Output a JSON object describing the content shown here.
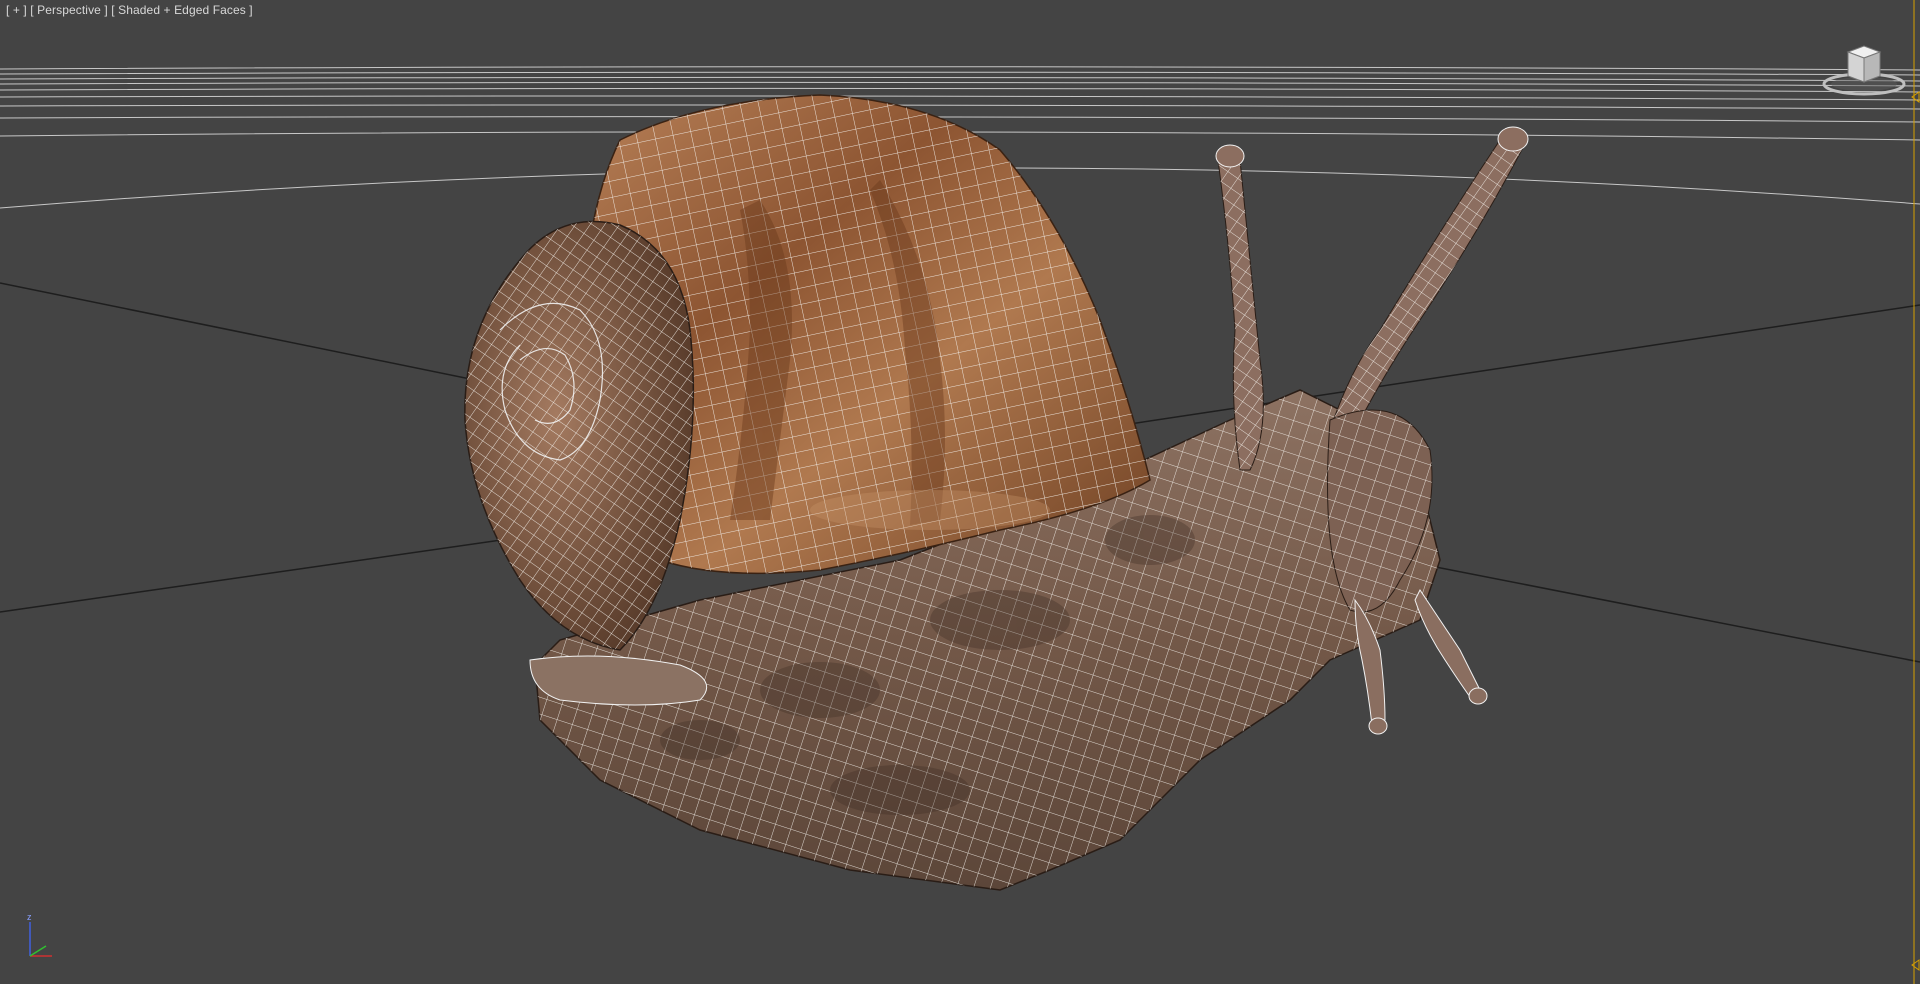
{
  "viewport": {
    "label_menu": "[ + ]",
    "label_view": "[ Perspective ]",
    "label_shading": "[ Shaded + Edged Faces ]"
  },
  "axis": {
    "z_label": "z"
  },
  "colors": {
    "background": "#444444",
    "grid_line": "#1e1e1e",
    "horizon_line": "#e8e8e8",
    "shell": "#9a6238",
    "body": "#7e6454",
    "wire": "#f2f2f2",
    "axis_x": "#d03030",
    "axis_y": "#30c030",
    "axis_z": "#4060e0",
    "track_marker": "#d6a000"
  },
  "icons": [
    "viewcube-icon",
    "axis-tripod-icon"
  ]
}
